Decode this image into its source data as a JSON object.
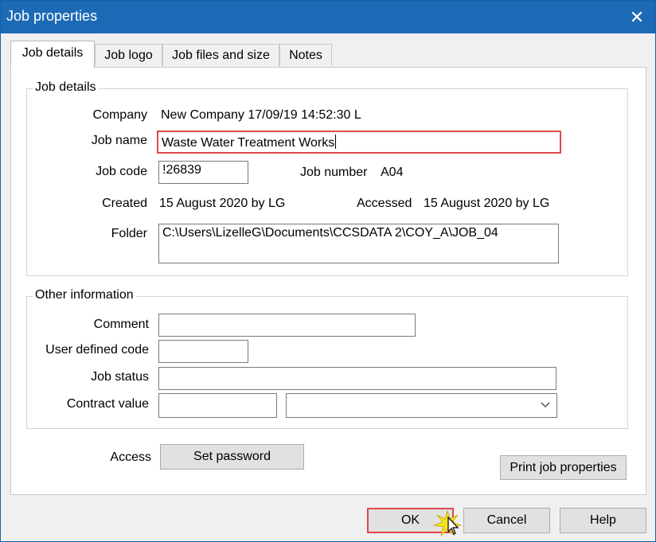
{
  "window": {
    "title": "Job properties",
    "close_glyph": "✕"
  },
  "tabs": [
    {
      "label": "Job details",
      "active": true
    },
    {
      "label": "Job logo",
      "active": false
    },
    {
      "label": "Job files and size",
      "active": false
    },
    {
      "label": "Notes",
      "active": false
    }
  ],
  "job_details": {
    "group_label": "Job details",
    "company_label": "Company",
    "company_value": "New Company 17/09/19 14:52:30 L",
    "job_name_label": "Job name",
    "job_name_value": "Waste Water Treatment Works",
    "job_code_label": "Job code",
    "job_code_value": "!26839",
    "job_number_label": "Job number",
    "job_number_value": "A04",
    "created_label": "Created",
    "created_value": "15 August 2020 by LG",
    "accessed_label": "Accessed",
    "accessed_value": "15 August 2020 by LG",
    "folder_label": "Folder",
    "folder_value": "C:\\Users\\LizelleG\\Documents\\CCSDATA 2\\COY_A\\JOB_04"
  },
  "other_info": {
    "group_label": "Other information",
    "comment_label": "Comment",
    "comment_value": "",
    "user_code_label": "User defined code",
    "user_code_value": "",
    "job_status_label": "Job status",
    "job_status_value": "",
    "contract_value_label": "Contract value",
    "contract_value_value": "",
    "currency_selected": ""
  },
  "access": {
    "label": "Access",
    "set_password_label": "Set password",
    "print_label": "Print job properties"
  },
  "footer": {
    "ok_label": "OK",
    "cancel_label": "Cancel",
    "help_label": "Help"
  },
  "colors": {
    "titlebar": "#1c6ab5",
    "highlight": "#e0474c",
    "cursor_burst": "#f5e21a"
  },
  "icons": {
    "close": "close-icon",
    "dropdown": "chevron-down-icon",
    "cursor": "mouse-pointer-icon"
  }
}
